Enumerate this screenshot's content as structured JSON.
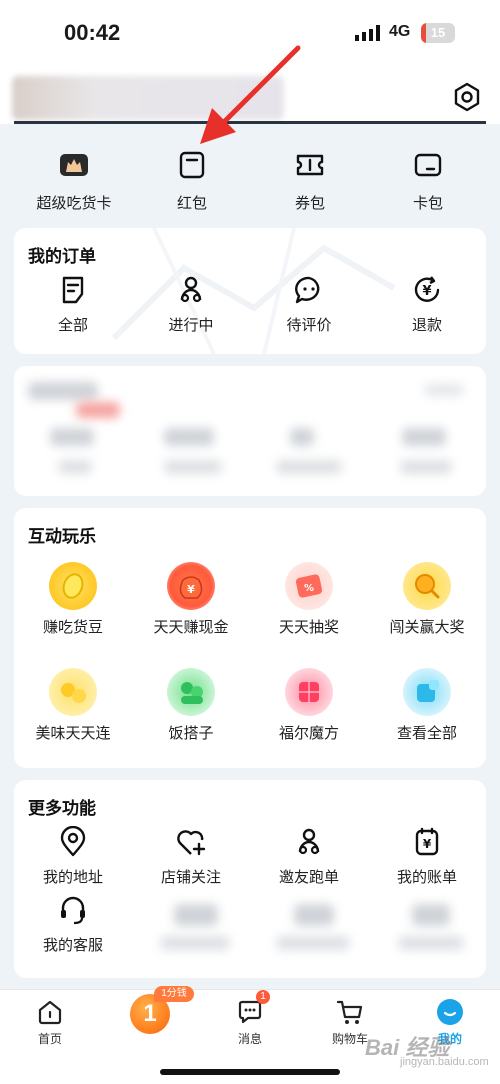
{
  "status": {
    "time": "00:42",
    "network": "4G",
    "battery": "15",
    "battery_level": 0.15
  },
  "wallet": [
    {
      "label": "超级吃货卡",
      "icon": "foodie-card-icon"
    },
    {
      "label": "红包",
      "icon": "red-packet-icon"
    },
    {
      "label": "券包",
      "icon": "coupon-icon"
    },
    {
      "label": "卡包",
      "icon": "card-wallet-icon"
    }
  ],
  "orders": {
    "title": "我的订单",
    "items": [
      {
        "label": "全部",
        "icon": "document-icon"
      },
      {
        "label": "进行中",
        "icon": "rider-icon"
      },
      {
        "label": "待评价",
        "icon": "chat-icon"
      },
      {
        "label": "退款",
        "icon": "refund-icon"
      }
    ]
  },
  "games": {
    "title": "互动玩乐",
    "items": [
      {
        "label": "赚吃货豆",
        "icon": "bean-icon",
        "color": "#ffd84a"
      },
      {
        "label": "天天赚现金",
        "icon": "money-bag-icon",
        "color": "#ff5a3c"
      },
      {
        "label": "天天抽奖",
        "icon": "ticket-icon",
        "color": "#ff7a6a"
      },
      {
        "label": "闯关赢大奖",
        "icon": "magnifier-icon",
        "color": "#ffc02e"
      },
      {
        "label": "美味天天连",
        "icon": "link-game-icon",
        "color": "#ffd84a"
      },
      {
        "label": "饭搭子",
        "icon": "buddy-icon",
        "color": "#3ccf6a"
      },
      {
        "label": "福尔魔方",
        "icon": "cube-icon",
        "color": "#ff4a6a"
      },
      {
        "label": "查看全部",
        "icon": "view-all-icon",
        "color": "#46c9ef"
      }
    ]
  },
  "more": {
    "title": "更多功能",
    "items": [
      {
        "label": "我的地址",
        "icon": "location-icon"
      },
      {
        "label": "店铺关注",
        "icon": "heart-plus-icon"
      },
      {
        "label": "邀友跑单",
        "icon": "rider-icon"
      },
      {
        "label": "我的账单",
        "icon": "bill-icon"
      },
      {
        "label": "我的客服",
        "icon": "headset-icon"
      }
    ]
  },
  "tabbar": {
    "items": [
      {
        "label": "首页",
        "icon": "home-icon"
      },
      {
        "label": "",
        "icon": "coin-one-icon"
      },
      {
        "label": "消息",
        "icon": "message-icon"
      },
      {
        "label": "购物车",
        "icon": "cart-icon"
      },
      {
        "label": "我的",
        "icon": "profile-icon"
      }
    ],
    "promo_badge": "1分钱",
    "coin_text": "1",
    "message_count": "1"
  },
  "watermark": {
    "main": "Bai 经验",
    "sub": "jingyan.baidu.com"
  },
  "colors": {
    "accent": "#1aa3e8",
    "dark": "#2a3340",
    "badge": "#ff5a3c",
    "annotation": "#e8302a"
  }
}
